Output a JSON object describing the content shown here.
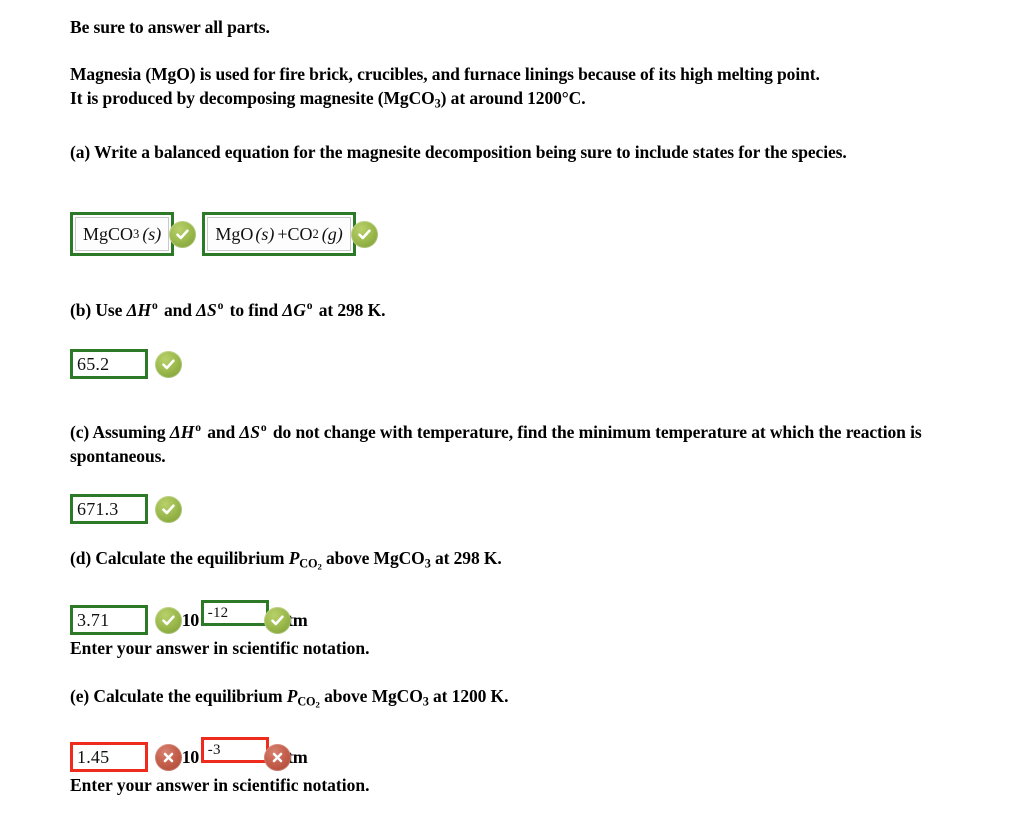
{
  "instructions": {
    "header": "Be sure to answer all parts.",
    "intro_line1": "Magnesia (MgO) is used for fire brick, crucibles, and furnace linings because of its high melting point.",
    "intro_line2_pre": "It is produced by decomposing magnesite (MgCO",
    "intro_line2_sub": "3",
    "intro_line2_post": ") at around 1200°C."
  },
  "parts": {
    "a": {
      "label": "(a)",
      "prompt": "Write a balanced equation for the magnesite decomposition being sure to include states for the species.",
      "reactant": {
        "formula_main": "MgCO",
        "formula_sub": "3",
        "state": "(s)",
        "status": "correct",
        "status_icon": "check-circle-icon"
      },
      "product": {
        "species1": "MgO",
        "state1": "(s)",
        "plus": "+CO",
        "species2_sub": "2",
        "state2": "(g)",
        "status": "correct",
        "status_icon": "check-circle-icon"
      }
    },
    "b": {
      "label": "(b)",
      "prompt_1": "Use",
      "sym_H": "ΔH",
      "sym_S": "ΔS",
      "sym_G": "ΔG",
      "degree": "o",
      "prompt_2": "and",
      "prompt_3": "to find",
      "prompt_4": "at 298 K.",
      "answer": "65.2",
      "status": "correct",
      "status_icon": "check-circle-icon"
    },
    "c": {
      "label": "(c)",
      "prompt_1": "Assuming",
      "sym_H": "ΔH",
      "sym_S": "ΔS",
      "degree": "o",
      "prompt_2": "and",
      "prompt_3": "do not change with temperature, find the minimum temperature at which the reaction is spontaneous.",
      "answer": "671.3",
      "status": "correct",
      "status_icon": "check-circle-icon"
    },
    "d": {
      "label": "(d)",
      "prompt_1": "Calculate the equilibrium",
      "sym_P": "P",
      "sym_P_sub": "CO",
      "sym_P_subsub": "2",
      "prompt_2": "above MgCO",
      "prompt_2_sub": "3",
      "prompt_3": "at 298 K.",
      "mantissa": "3.71",
      "times_ten": "×10",
      "exponent": "-12",
      "unit": "atm",
      "mantissa_status": "correct",
      "mantissa_status_icon": "check-circle-icon",
      "exponent_status": "correct",
      "exponent_status_icon": "check-circle-icon",
      "hint": "Enter your answer in scientific notation."
    },
    "e": {
      "label": "(e)",
      "prompt_1": "Calculate the equilibrium",
      "sym_P": "P",
      "sym_P_sub": "CO",
      "sym_P_subsub": "2",
      "prompt_2": "above MgCO",
      "prompt_2_sub": "3",
      "prompt_3": "at 1200 K.",
      "mantissa": "1.45",
      "times_ten": "×10",
      "exponent": "-3",
      "unit": "atm",
      "mantissa_status": "incorrect",
      "mantissa_status_icon": "x-circle-icon",
      "exponent_status": "incorrect",
      "exponent_status_icon": "x-circle-icon",
      "hint": "Enter your answer in scientific notation."
    }
  },
  "colors": {
    "correct_border": "#2c7a28",
    "incorrect_border": "#ef2b1e",
    "correct_icon": "#9dbb4e",
    "incorrect_icon": "#c4604c",
    "text": "#000000",
    "background": "#ffffff"
  }
}
